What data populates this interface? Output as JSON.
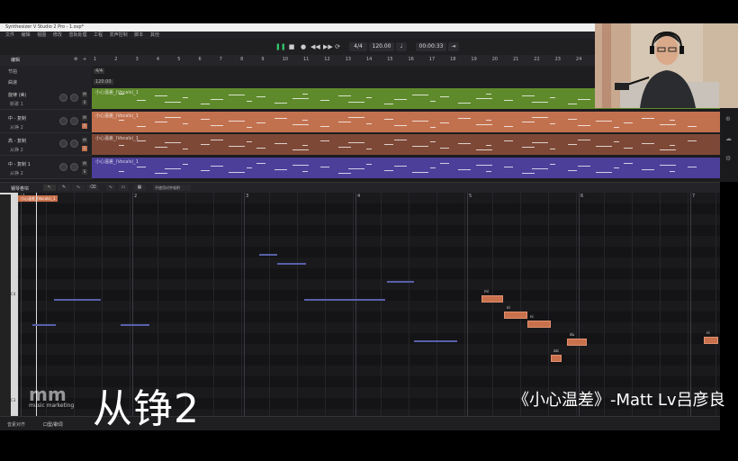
{
  "window_title": "Synthesizer V Studio 2 Pro - 1.svp*",
  "menu": [
    "文件",
    "编辑",
    "视图",
    "修改",
    "音轨处理",
    "工程",
    "发声控制",
    "脚本",
    "其他"
  ],
  "transport": {
    "time_sig": "4/4",
    "tempo": "120.00",
    "time": "00:00:33"
  },
  "track_header": {
    "label": "编辑"
  },
  "ruler_bars": [
    "1",
    "2",
    "3",
    "4",
    "5",
    "6",
    "7",
    "8",
    "9",
    "10",
    "11",
    "12",
    "13",
    "14",
    "15",
    "16",
    "17",
    "18",
    "19",
    "20",
    "21",
    "22",
    "23",
    "24"
  ],
  "meta_rows": [
    {
      "label": "节拍",
      "value": "4/4"
    },
    {
      "label": "曲速",
      "value": "120.00"
    }
  ],
  "tracks": [
    {
      "name": "旋律 (美)",
      "voice": "新歌 1",
      "clip": "小心温差_(Vocals)_1",
      "color": "#5f8a2c"
    },
    {
      "name": "中 - 复制",
      "voice": "从铮 2",
      "clip": "小心温差_(Vocals)_1",
      "color": "#c2714f"
    },
    {
      "name": "高 - 复制",
      "voice": "从铮 2",
      "clip": "小心温差_(Vocals)_1",
      "color": "#7d4836"
    },
    {
      "name": "中 - 复制 1",
      "voice": "从铮 2",
      "clip": "小心温差_(Vocals)_1",
      "color": "#4c3f9a"
    }
  ],
  "piano_roll": {
    "label": "钢琴卷帘",
    "dropdown": "不使用对齐吸附",
    "clip_tag": "小心温差_(Vocals)_1",
    "bars": [
      "1",
      "2",
      "3",
      "4",
      "5",
      "6",
      "7"
    ],
    "key_labels": [
      "C4",
      "C3"
    ],
    "lyrics": [
      "mi",
      "ni",
      "ni",
      "zai",
      "du",
      "ni"
    ]
  },
  "bottom_tabs": [
    "音素对齐",
    "口型/歌词"
  ],
  "captions": {
    "left": "从铮2",
    "right": "《小心温差》-Matt Lv吕彦良",
    "logo_main": "mm",
    "logo_sub": "music marketing"
  },
  "colors": {
    "accent": "#35c46a",
    "vocal_note": "#c9714c",
    "ref_note": "#5860a8"
  }
}
